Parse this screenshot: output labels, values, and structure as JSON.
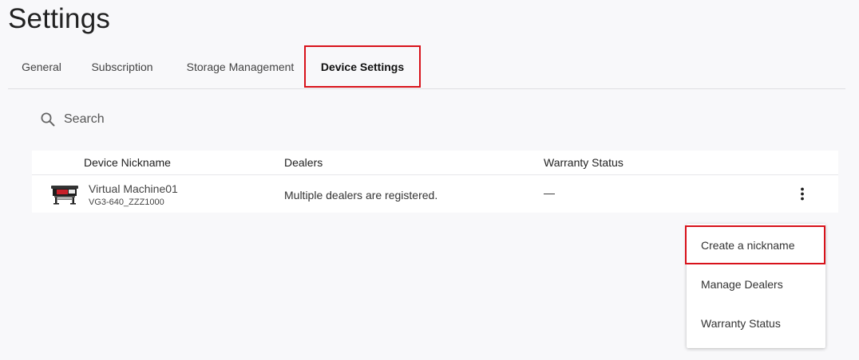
{
  "page": {
    "title": "Settings"
  },
  "tabs": [
    {
      "label": "General",
      "active": false
    },
    {
      "label": "Subscription",
      "active": false
    },
    {
      "label": "Storage Management",
      "active": false
    },
    {
      "label": "Device Settings",
      "active": true
    }
  ],
  "search": {
    "placeholder": "Search",
    "value": "",
    "icon": "search-icon"
  },
  "table": {
    "columns": [
      "Device Nickname",
      "Dealers",
      "Warranty Status"
    ],
    "rows": [
      {
        "icon": "printer-icon",
        "nickname": "Virtual Machine01",
        "model": "VG3-640_ZZZ1000",
        "dealers": "Multiple dealers are registered.",
        "warranty": "—",
        "actions_icon": "more-vertical-icon"
      }
    ]
  },
  "menu": {
    "items": [
      "Create a nickname",
      "Manage Dealers",
      "Warranty Status"
    ],
    "highlighted_index": 0
  },
  "colors": {
    "highlight_border": "#d8121a",
    "background": "#f8f8fa",
    "surface": "#ffffff"
  }
}
